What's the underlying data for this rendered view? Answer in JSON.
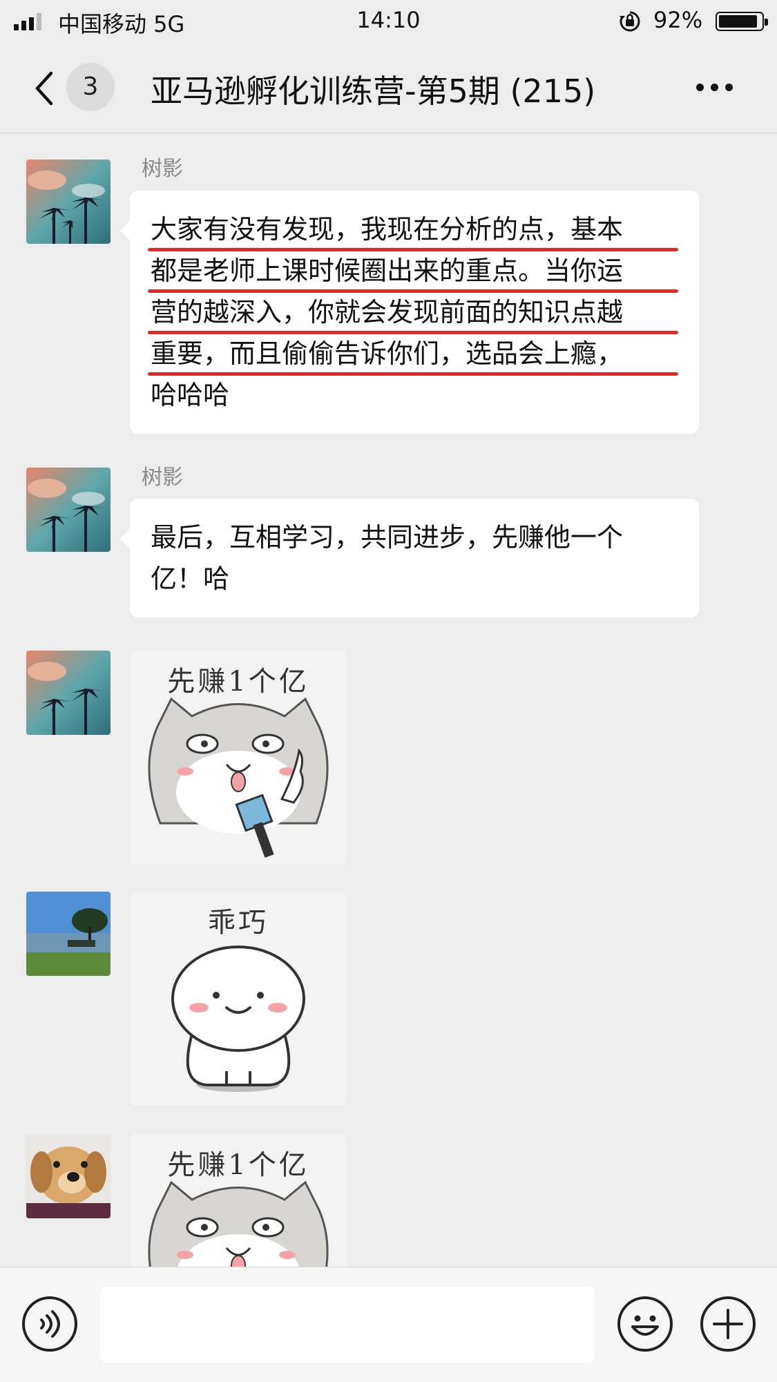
{
  "status_bar": {
    "carrier": "中国移动  5G",
    "time": "14:10",
    "battery": "92%",
    "battery_level": 0.92,
    "icons": [
      "signal-icon",
      "rotation-lock-icon",
      "battery-icon"
    ]
  },
  "nav": {
    "unread_count": "3",
    "title": "亚马逊孵化训练营-第5期 (215)",
    "icons": [
      "back-chevron-icon",
      "more-icon"
    ]
  },
  "messages": [
    {
      "sender": "树影",
      "type": "text",
      "lines": [
        "大家有没有发现，我现在分析的点，基本",
        "都是老师上课时候圈出来的重点。当你运",
        "营的越深入，你就会发现前面的知识点越",
        "重要，而且偷偷告诉你们，选品会上瘾，",
        "哈哈哈"
      ]
    },
    {
      "sender": "树影",
      "type": "text",
      "lines": [
        "最后，互相学习，共同进步，先赚他一个",
        "亿！哈"
      ]
    },
    {
      "type": "sticker",
      "caption": "先赚1个亿"
    },
    {
      "type": "sticker",
      "caption": "乖巧"
    },
    {
      "type": "sticker",
      "caption": "先赚1个亿"
    }
  ],
  "input_bar": {
    "icons": [
      "voice-icon",
      "emoji-icon",
      "plus-icon"
    ],
    "text_value": ""
  },
  "colors": {
    "background": "#EDEDED",
    "bubble": "#FFFFFF",
    "highlight_underline": "#E02A2A",
    "sender_name": "#8A8A8A"
  }
}
